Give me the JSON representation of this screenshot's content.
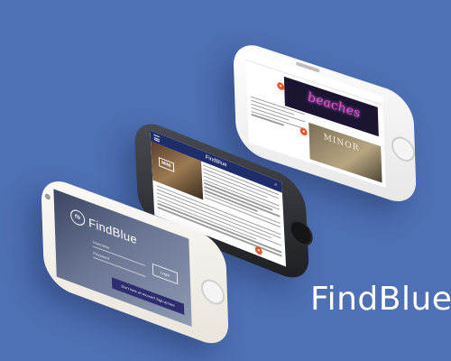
{
  "brand": {
    "name": "FindBlue"
  },
  "phone_login": {
    "logo_text": "FindBlue",
    "logo_badge": "fb",
    "username_placeholder": "Username",
    "password_placeholder": "Password",
    "login_label": "Login",
    "signup_text": "Don't have an account? Sign up here"
  },
  "phone_article": {
    "header_title": "FindBlue",
    "search_icon": "search-icon",
    "menu_icon": "hamburger-menu-icon",
    "hero_caption": "MINI"
  },
  "phone_feed": {
    "neon_sign": "beaches",
    "card2_text": "MINOR"
  },
  "colors": {
    "background": "#4e70b4",
    "header": "#1f2d6b",
    "accent": "#e8542c"
  }
}
